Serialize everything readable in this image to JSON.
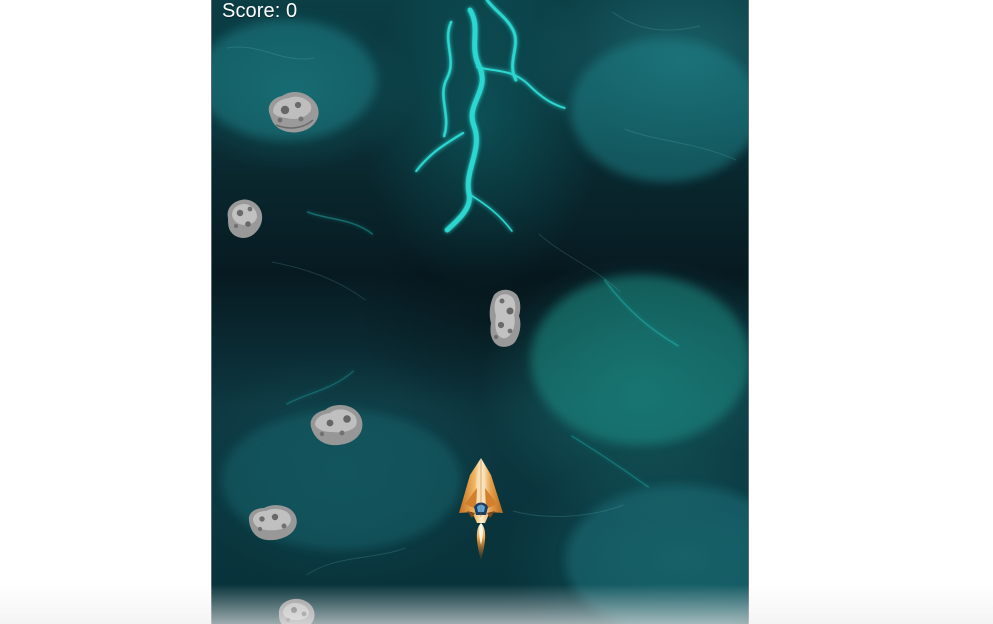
{
  "game": {
    "score_label": "Score: 0",
    "icons": {
      "player_ship": "spaceship-icon",
      "asteroid": "asteroid-icon"
    },
    "colors": {
      "space_dark": "#071a21",
      "nebula_teal": "#2fe0d8",
      "score_text": "#ffffff",
      "asteroid_light": "#b9b9b9",
      "ship_orange": "#f0a53a"
    }
  }
}
